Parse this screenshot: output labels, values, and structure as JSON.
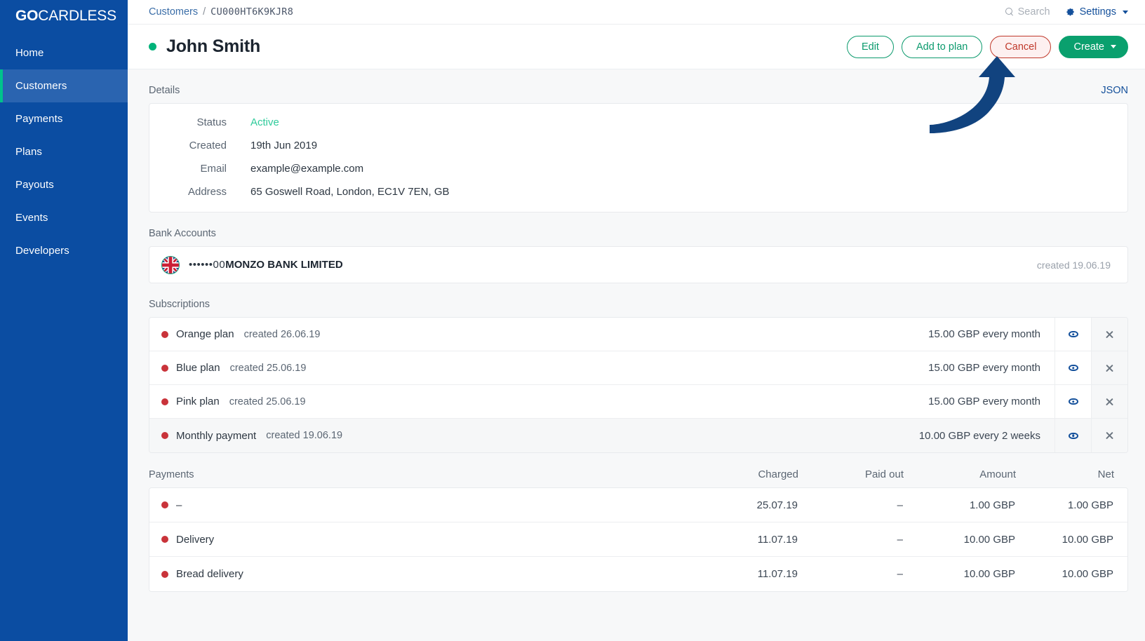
{
  "brand": {
    "go": "GO",
    "cardless": "CARDLESS"
  },
  "sidebar": {
    "items": [
      {
        "label": "Home",
        "active": false
      },
      {
        "label": "Customers",
        "active": true
      },
      {
        "label": "Payments",
        "active": false
      },
      {
        "label": "Plans",
        "active": false
      },
      {
        "label": "Payouts",
        "active": false
      },
      {
        "label": "Events",
        "active": false
      },
      {
        "label": "Developers",
        "active": false
      }
    ]
  },
  "topbar": {
    "breadcrumb_root": "Customers",
    "breadcrumb_sep": "/",
    "breadcrumb_id": "CU000HT6K9KJR8",
    "search_placeholder": "Search",
    "settings_label": "Settings"
  },
  "pagehead": {
    "title": "John Smith",
    "status_color": "#00b37a",
    "buttons": {
      "edit": "Edit",
      "add_to_plan": "Add to plan",
      "cancel": "Cancel",
      "create": "Create"
    }
  },
  "details": {
    "section_label": "Details",
    "json_link": "JSON",
    "rows": [
      {
        "label": "Status",
        "value": "Active"
      },
      {
        "label": "Created",
        "value": "19th Jun 2019"
      },
      {
        "label": "Email",
        "value": "example@example.com"
      },
      {
        "label": "Address",
        "value": "65 Goswell Road, London, EC1V 7EN, GB"
      }
    ]
  },
  "bank_accounts": {
    "section_label": "Bank Accounts",
    "rows": [
      {
        "masked": "••••••00",
        "bank": "MONZO BANK LIMITED",
        "created": "created 19.06.19"
      }
    ]
  },
  "subscriptions": {
    "section_label": "Subscriptions",
    "rows": [
      {
        "name": "Orange plan",
        "created": "created 26.06.19",
        "amount": "15.00 GBP every month",
        "hover": false
      },
      {
        "name": "Blue plan",
        "created": "created 25.06.19",
        "amount": "15.00 GBP every month",
        "hover": false
      },
      {
        "name": "Pink plan",
        "created": "created 25.06.19",
        "amount": "15.00 GBP every month",
        "hover": false
      },
      {
        "name": "Monthly payment",
        "created": "created 19.06.19",
        "amount": "10.00 GBP every 2 weeks",
        "hover": true
      }
    ]
  },
  "payments": {
    "section_label": "Payments",
    "columns": {
      "charged": "Charged",
      "paid_out": "Paid out",
      "amount": "Amount",
      "net": "Net"
    },
    "rows": [
      {
        "name": "–",
        "charged": "25.07.19",
        "paid_out": "–",
        "amount": "1.00 GBP",
        "net": "1.00 GBP"
      },
      {
        "name": "Delivery",
        "charged": "11.07.19",
        "paid_out": "–",
        "amount": "10.00 GBP",
        "net": "10.00 GBP"
      },
      {
        "name": "Bread delivery",
        "charged": "11.07.19",
        "paid_out": "–",
        "amount": "10.00 GBP",
        "net": "10.00 GBP"
      }
    ]
  },
  "annotation": {
    "arrow_color": "#11437f",
    "points_to": "Cancel"
  }
}
